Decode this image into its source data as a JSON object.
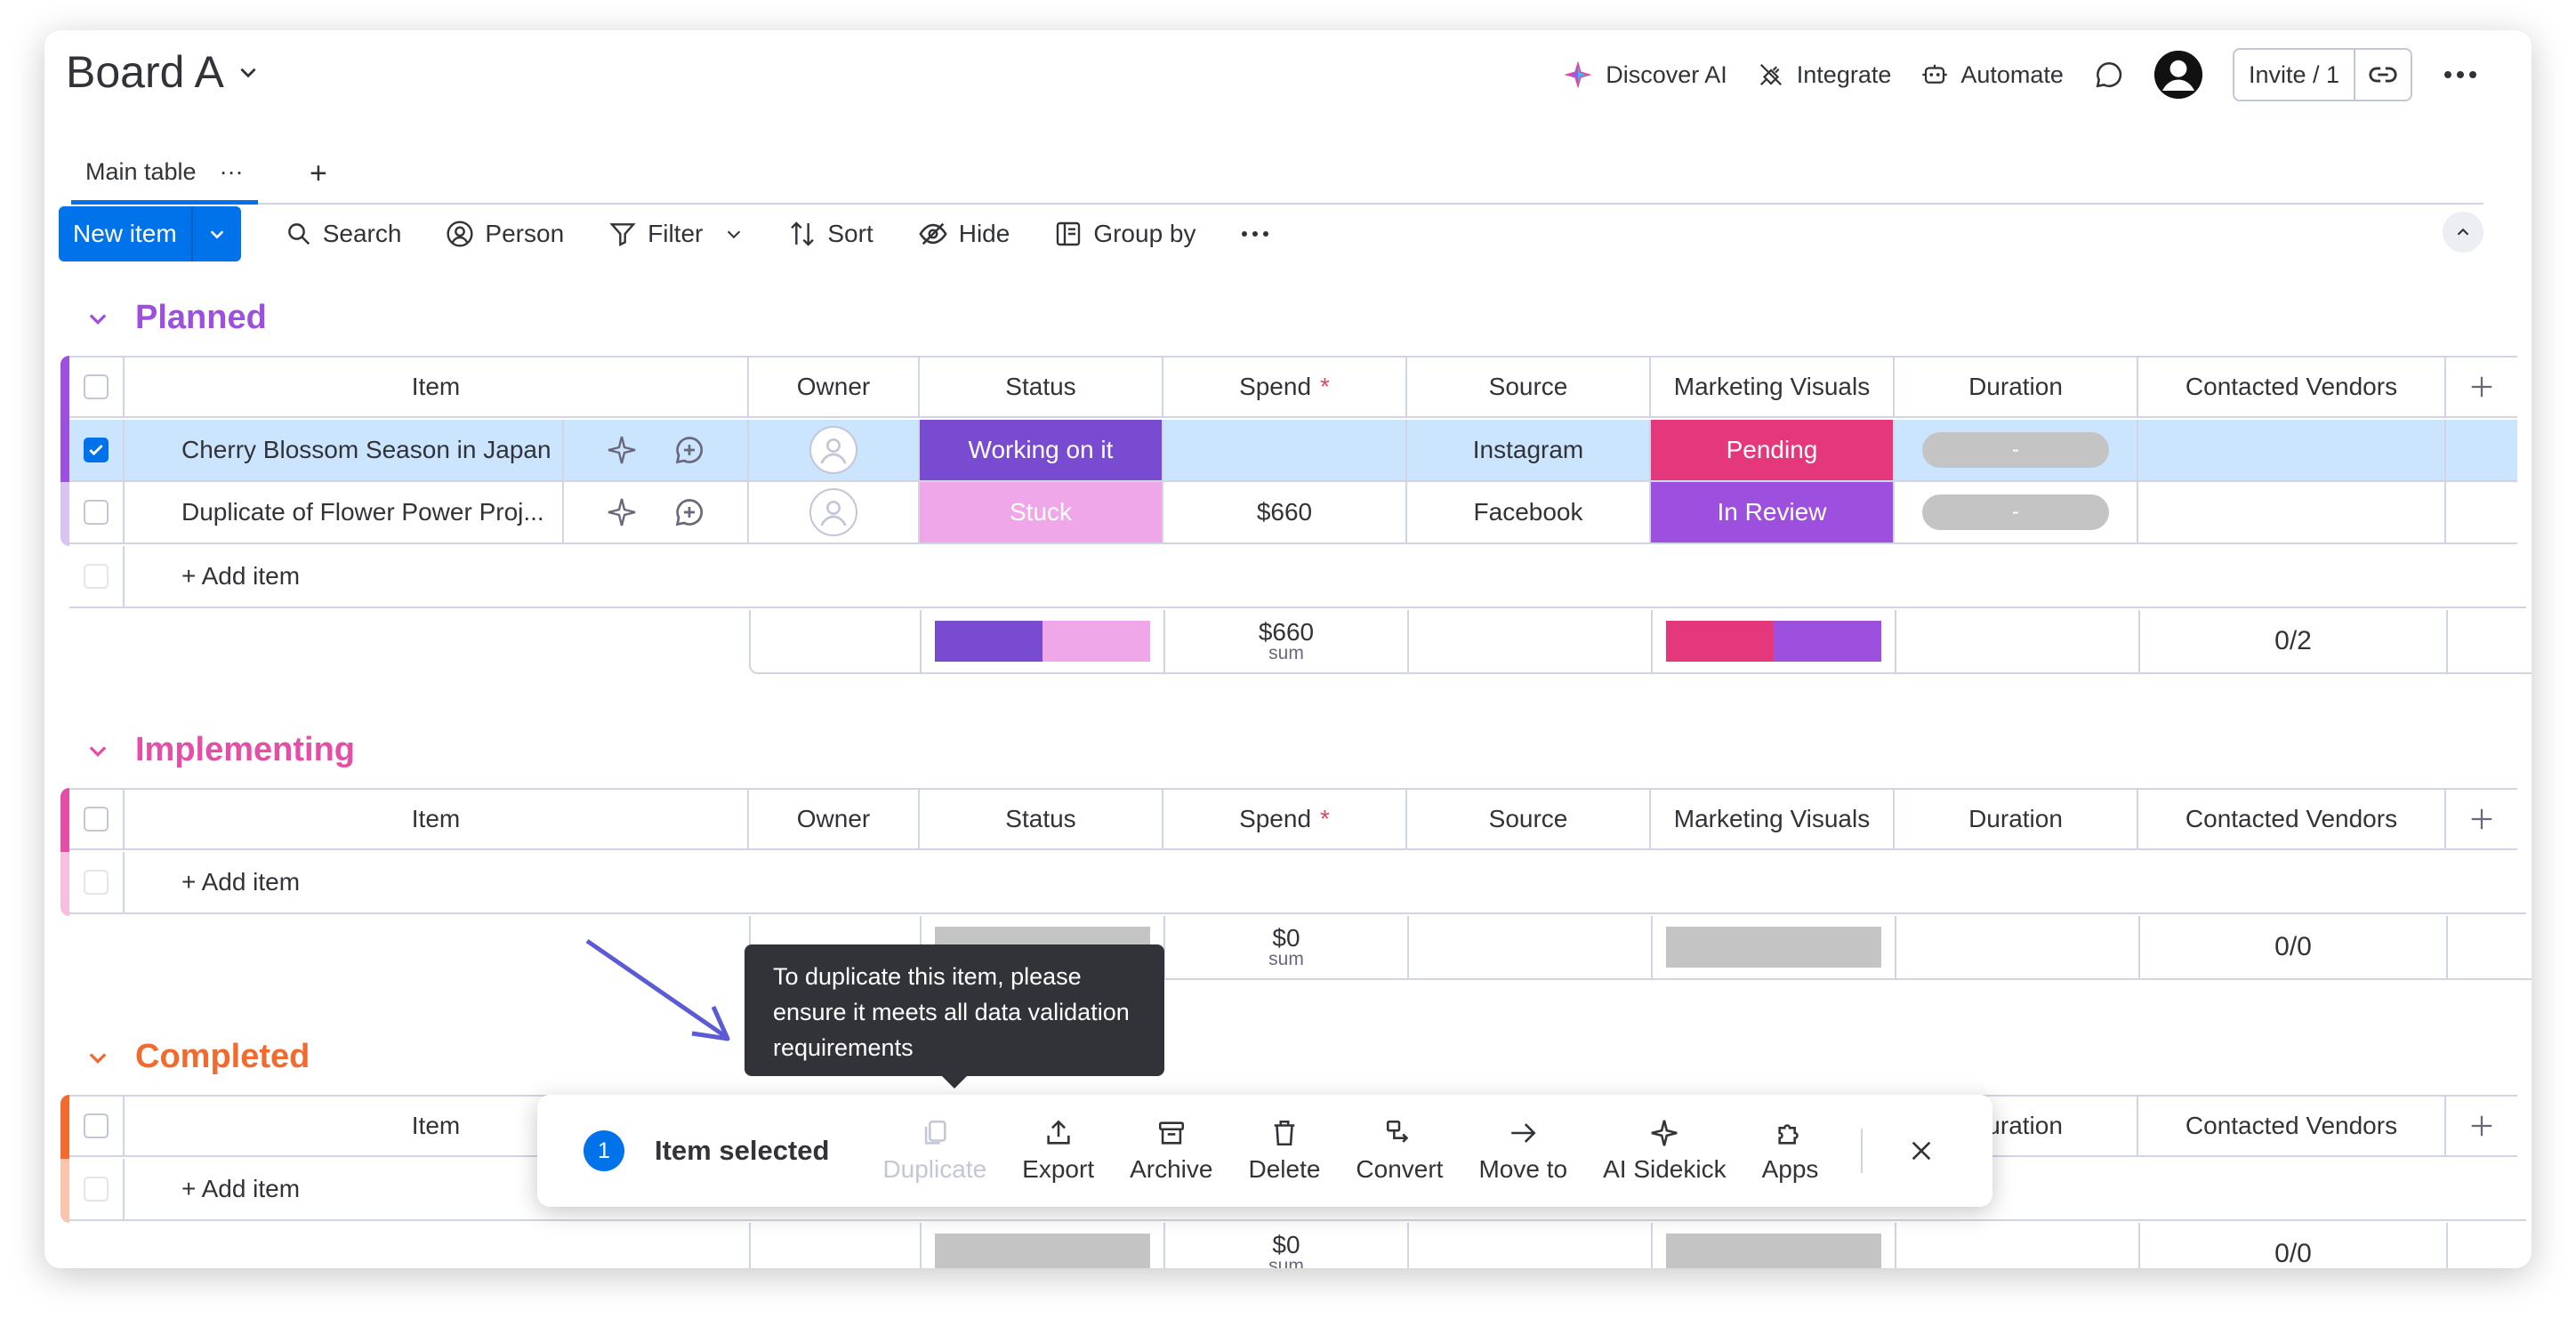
{
  "board": {
    "title": "Board A"
  },
  "top_actions": {
    "discover_ai": "Discover AI",
    "integrate": "Integrate",
    "automate": "Automate",
    "invite": "Invite / 1"
  },
  "tabs": {
    "main": "Main table",
    "more": "···",
    "add": "+"
  },
  "toolbar": {
    "new_item": "New item",
    "search": "Search",
    "person": "Person",
    "filter": "Filter",
    "sort": "Sort",
    "hide": "Hide",
    "group_by": "Group by"
  },
  "columns": [
    "Item",
    "Owner",
    "Status",
    "Spend",
    "Source",
    "Marketing Visuals",
    "Duration",
    "Contacted Vendors"
  ],
  "required_mark": "*",
  "add_item": "+ Add item",
  "groups": [
    {
      "title": "Planned",
      "color": "#9d50dd",
      "rows": [
        {
          "item": "Cherry Blossom Season in Japan",
          "status": "Working on it",
          "status_color": "#784bd1",
          "spend": "",
          "source": "Instagram",
          "visuals": "Pending",
          "visuals_color": "#e2445c",
          "duration": "-",
          "selected": true
        },
        {
          "item": "Duplicate of Flower Power Proj...",
          "status": "Stuck",
          "status_color": "#f4a4e8",
          "spend": "$660",
          "source": "Facebook",
          "visuals": "In Review",
          "visuals_color": "#9d50dd",
          "duration": "-",
          "selected": false
        }
      ],
      "summary": {
        "spend": "$660",
        "spend_label": "sum",
        "vendors": "0/2"
      }
    },
    {
      "title": "Implementing",
      "color": "#e44ea6",
      "rows": [],
      "summary": {
        "spend": "$0",
        "spend_label": "sum",
        "vendors": "0/0"
      }
    },
    {
      "title": "Completed",
      "color": "#f26a2e",
      "rows": [],
      "summary": {
        "spend": "$0",
        "spend_label": "sum",
        "vendors": "0/0"
      }
    }
  ],
  "tooltip": {
    "text": "To duplicate this item, please ensure it meets all data validation requirements"
  },
  "bulk_bar": {
    "count": "1",
    "label": "Item selected",
    "actions": [
      "Duplicate",
      "Export",
      "Archive",
      "Delete",
      "Convert",
      "Move to",
      "AI Sidekick",
      "Apps"
    ]
  },
  "colors": {
    "primary": "#0073ea",
    "selected_row": "#cce5ff",
    "arrow": "#5b5bd6"
  }
}
